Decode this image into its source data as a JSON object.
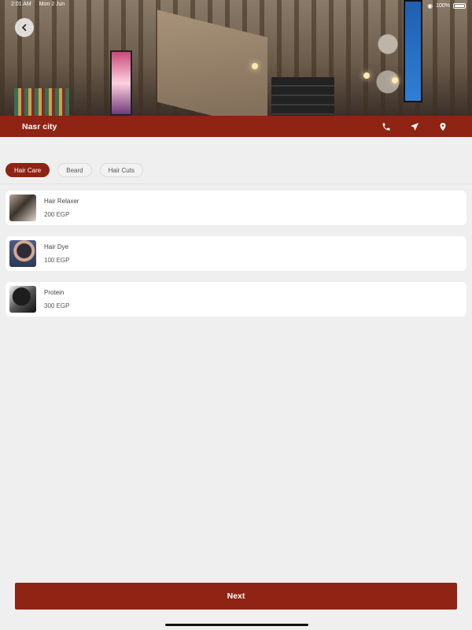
{
  "status_bar": {
    "time": "2:01 AM",
    "date": "Mon 2 Jun",
    "battery": "100%"
  },
  "header": {
    "back_icon": "chevron-left-icon"
  },
  "branch": {
    "name": "Nasr city",
    "actions": [
      {
        "icon": "phone-icon"
      },
      {
        "icon": "send-icon"
      },
      {
        "icon": "location-pin-icon"
      }
    ]
  },
  "tabs": [
    {
      "label": "Hair Care",
      "active": true
    },
    {
      "label": "Beard",
      "active": false
    },
    {
      "label": "Hair Cuts",
      "active": false
    }
  ],
  "services": [
    {
      "name": "Hair Relaxer",
      "price": "200 EGP"
    },
    {
      "name": "Hair Dye",
      "price": "100 EGP"
    },
    {
      "name": "Protein",
      "price": "300 EGP"
    }
  ],
  "footer": {
    "next_label": "Next"
  },
  "colors": {
    "brand": "#8f2314",
    "background": "#efefef",
    "card": "#ffffff"
  }
}
